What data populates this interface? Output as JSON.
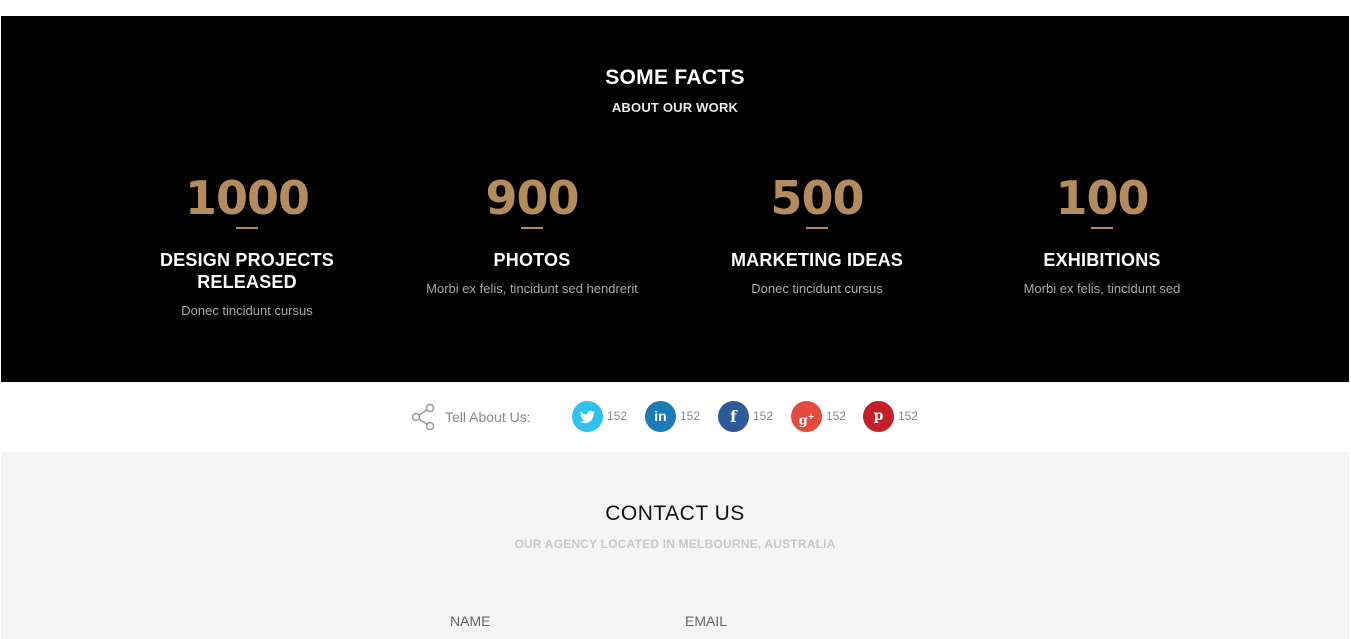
{
  "facts": {
    "title": "SOME FACTS",
    "subtitle": "ABOUT OUR WORK",
    "items": [
      {
        "number": "1000",
        "title": "DESIGN PROJECTS RELEASED",
        "desc": "Donec tincidunt cursus"
      },
      {
        "number": "900",
        "title": "PHOTOS",
        "desc": "Morbi ex felis, tincidunt sed hendrerit"
      },
      {
        "number": "500",
        "title": "MARKETING IDEAS",
        "desc": "Donec tincidunt cursus"
      },
      {
        "number": "100",
        "title": "EXHIBITIONS",
        "desc": "Morbi ex felis, tincidunt sed"
      }
    ],
    "accent_color": "#b38b5d"
  },
  "share": {
    "label": "Tell About Us:",
    "networks": [
      {
        "name": "twitter",
        "icon": "twitter-icon",
        "color": "#2fc2ef",
        "count": "152"
      },
      {
        "name": "linkedin",
        "icon": "linkedin-icon",
        "color": "#1a7bb9",
        "count": "152"
      },
      {
        "name": "facebook",
        "icon": "facebook-icon",
        "color": "#2f5a99",
        "count": "152"
      },
      {
        "name": "googleplus",
        "icon": "google-plus-icon",
        "color": "#e64a3c",
        "count": "152"
      },
      {
        "name": "pinterest",
        "icon": "pinterest-icon",
        "color": "#c32127",
        "count": "152"
      }
    ]
  },
  "contact": {
    "title": "CONTACT US",
    "subtitle": "OUR AGENCY LOCATED IN MELBOURNE, AUSTRALIA",
    "name_label": "NAME",
    "email_label": "EMAIL"
  }
}
